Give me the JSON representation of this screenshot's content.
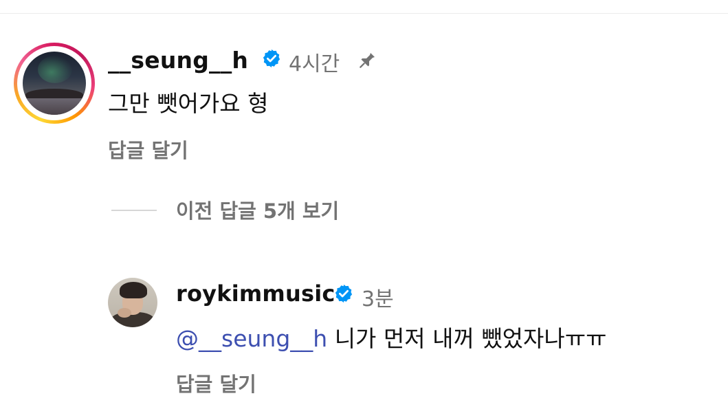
{
  "comments": [
    {
      "username": "__seung__h",
      "verified": true,
      "time": "4시간",
      "pinned": true,
      "text": "그만 뺏어가요 형",
      "reply_label": "답글 달기"
    }
  ],
  "view_previous_replies": "이전 답글 5개 보기",
  "reply": {
    "username": "roykimmusic",
    "verified": true,
    "time": "3분",
    "mention": "@__seung__h",
    "text": " 니가 먼저 내꺼 뺐었자나ㅠㅠ",
    "reply_label": "답글 달기"
  },
  "colors": {
    "verified_blue": "#0095f6",
    "mention_blue": "#3d4fb0",
    "secondary_gray": "#737373"
  },
  "icons": {
    "verified": "verified-badge-icon",
    "pin": "pin-icon"
  }
}
